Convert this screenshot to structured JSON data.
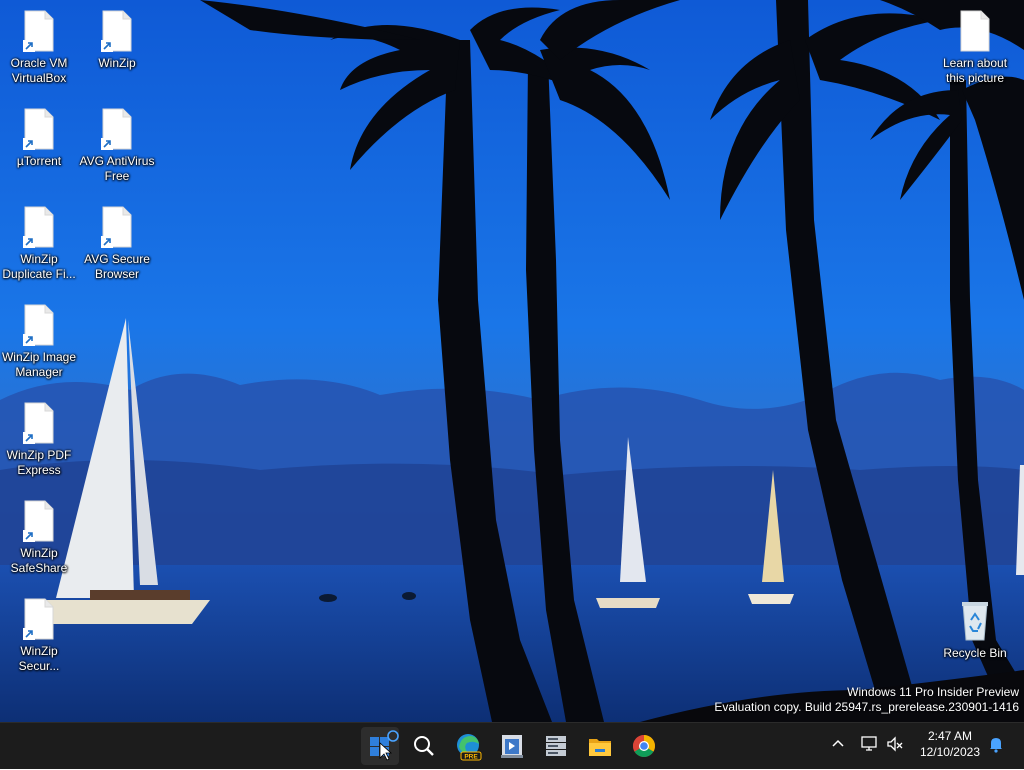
{
  "desktop": {
    "icons": [
      {
        "label": "Oracle VM VirtualBox"
      },
      {
        "label": "WinZip"
      },
      {
        "label": "µTorrent"
      },
      {
        "label": "AVG AntiVirus Free"
      },
      {
        "label": "WinZip Duplicate Fi..."
      },
      {
        "label": "AVG Secure Browser"
      },
      {
        "label": "WinZip Image Manager"
      },
      {
        "label": "WinZip PDF Express"
      },
      {
        "label": "WinZip SafeShare"
      },
      {
        "label": "WinZip Secur..."
      },
      {
        "label": "Learn about this picture"
      },
      {
        "label": "Recycle Bin"
      }
    ],
    "watermark": {
      "line1": "Windows 11 Pro Insider Preview",
      "line2": "Evaluation copy. Build 25947.rs_prerelease.230901-1416"
    }
  },
  "taskbar": {
    "apps": [
      {
        "icon": "windows-start-icon"
      },
      {
        "icon": "search-icon"
      },
      {
        "icon": "edge-preview-icon",
        "badge": "PRE"
      },
      {
        "icon": "visual-studio-installer-icon"
      },
      {
        "icon": "server-manager-icon"
      },
      {
        "icon": "file-explorer-icon"
      },
      {
        "icon": "chrome-icon"
      }
    ],
    "tray": {
      "chevron": "chevron-up-icon",
      "network": "network-icon",
      "volume": "volume-muted-icon",
      "notifications": "bell-icon"
    },
    "clock": {
      "time": "2:47 AM",
      "date": "12/10/2023"
    }
  },
  "colors": {
    "taskbar": "#1c1c1c",
    "accent": "#0a6cd6"
  }
}
